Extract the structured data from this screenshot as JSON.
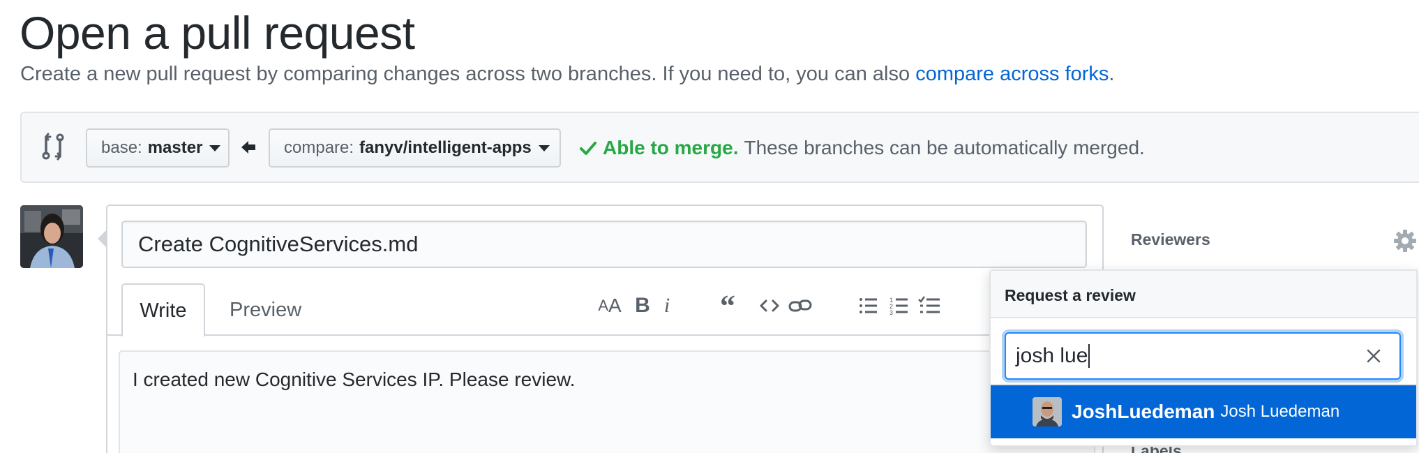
{
  "header": {
    "title": "Open a pull request",
    "subtitle": "Create a new pull request by comparing changes across two branches. If you need to, you can also ",
    "subtitle_link": "compare across forks",
    "subtitle_end": "."
  },
  "range": {
    "base_prefix": "base:",
    "base_value": "master",
    "compare_prefix": "compare:",
    "compare_value": "fanyv/intelligent-apps",
    "merge_ok": "Able to merge.",
    "merge_text": "These branches can be automatically merged."
  },
  "form": {
    "title_value": "Create CognitiveServices.md",
    "tabs": [
      "Write",
      "Preview"
    ],
    "toolbar": [
      "header-icon",
      "bold-icon",
      "italic-icon",
      "quote-icon",
      "code-icon",
      "link-icon",
      "bullet-list-icon",
      "numbered-list-icon",
      "task-list-icon"
    ],
    "body_text": "I created new Cognitive Services IP. Please review."
  },
  "sidebar": {
    "reviewers_label": "Reviewers",
    "labels_label": "Labels"
  },
  "popover": {
    "header": "Request a review",
    "filter_value": "josh lue",
    "suggestion_login": "JoshLuedeman",
    "suggestion_name": "Josh Luedeman"
  },
  "colors": {
    "link": "#0366d6",
    "success": "#28a745",
    "selected_bg": "#0366d6",
    "focus_border": "#2188ff"
  }
}
